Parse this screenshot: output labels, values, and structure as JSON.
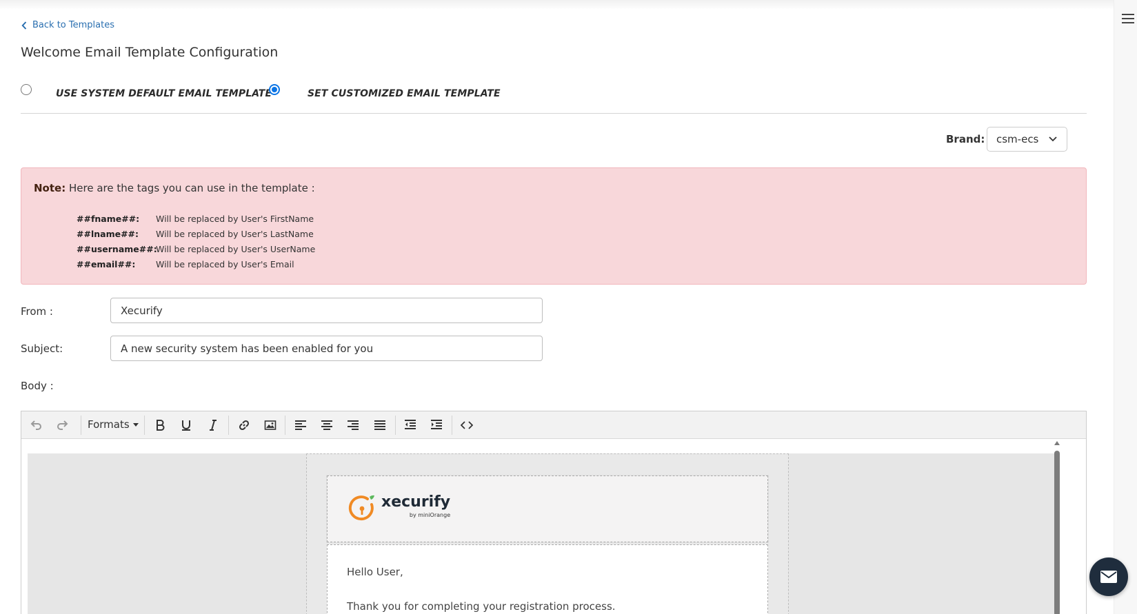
{
  "nav": {
    "back_label": "Back to Templates"
  },
  "page": {
    "title": "Welcome Email Template Configuration"
  },
  "template_options": [
    {
      "label": "USE SYSTEM DEFAULT EMAIL TEMPLATE",
      "selected": false
    },
    {
      "label": "SET CUSTOMIZED EMAIL TEMPLATE",
      "selected": true
    }
  ],
  "brand": {
    "label": "Brand:",
    "value": "csm-ecs"
  },
  "note": {
    "prefix": "Note:",
    "text": "Here are the tags you can use in the template :",
    "tags": [
      {
        "tag": "##fname##:",
        "desc": "Will be replaced by User's FirstName"
      },
      {
        "tag": "##lname##:",
        "desc": "Will be replaced by User's LastName"
      },
      {
        "tag": "##username##:",
        "desc": "Will be replaced by User's UserName"
      },
      {
        "tag": "##email##:",
        "desc": "Will be replaced by User's Email"
      }
    ]
  },
  "form": {
    "from_label": "From :",
    "from_value": "Xecurify",
    "subject_label": "Subject:",
    "subject_value": "A new security system has been enabled for you",
    "body_label": "Body :"
  },
  "editor": {
    "formats_label": "Formats",
    "toolbar_icons": [
      "undo-icon",
      "redo-icon",
      "bold-icon",
      "underline-icon",
      "italic-icon",
      "link-icon",
      "image-icon",
      "align-left-icon",
      "align-center-icon",
      "align-right-icon",
      "align-justify-icon",
      "outdent-icon",
      "indent-icon",
      "source-code-icon"
    ]
  },
  "email_preview": {
    "logo_text": "xecurify",
    "logo_sub": "by miniOrange",
    "greeting": "Hello  User,",
    "line1": "Thank you for completing your registration process."
  },
  "colors": {
    "accent": "#0b74e5",
    "link": "#2a6fb0",
    "note_bg": "#f8d7da",
    "logo_orange": "#f08a24",
    "chat_bg": "#1f2d3d"
  }
}
